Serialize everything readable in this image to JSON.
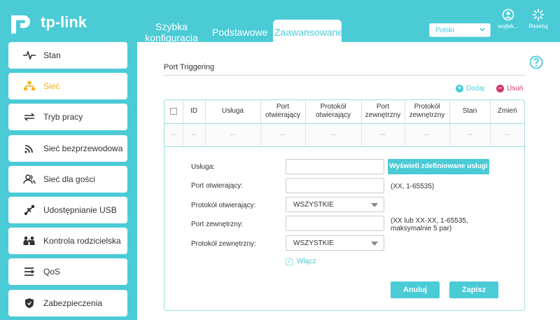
{
  "brand": {
    "logo_text": "tp-link"
  },
  "tabs": {
    "quick": "Szybka konfiguracja",
    "basic": "Podstawowe",
    "advanced": "Zaawansowane"
  },
  "language": {
    "selected": "Polski"
  },
  "header_icons": {
    "user": "wojtek...",
    "reset": "Resetuj"
  },
  "sidebar": {
    "items": [
      {
        "label": "Stan",
        "icon": "pulse-icon"
      },
      {
        "label": "Sieć",
        "icon": "network-icon",
        "active": true
      },
      {
        "label": "Tryb pracy",
        "icon": "mode-arrows-icon"
      },
      {
        "label": "Sieć bezprzewodowa",
        "icon": "wifi-icon"
      },
      {
        "label": "Sieć dla gości",
        "icon": "guests-icon"
      },
      {
        "label": "Udostępnianie USB",
        "icon": "usb-icon"
      },
      {
        "label": "Kontrola rodzicielska",
        "icon": "family-icon"
      },
      {
        "label": "QoS",
        "icon": "qos-icon"
      },
      {
        "label": "Zabezpieczenia",
        "icon": "shield-icon"
      }
    ]
  },
  "section": {
    "title": "Port Triggering"
  },
  "actions": {
    "add": "Dodaj",
    "delete": "Usuń"
  },
  "table": {
    "headers": [
      "ID",
      "Usługa",
      "Port otwierający",
      "Protokół otwierający",
      "Port zewnętrzny",
      "Protokół zewnętrzny",
      "Stan",
      "Zmień"
    ],
    "empty_row": [
      "--",
      "--",
      "--",
      "--",
      "--",
      "--",
      "--",
      "--",
      "--"
    ]
  },
  "form": {
    "service_label": "Usługa:",
    "show_services_button": "Wyświetl zdefiniowane usługi",
    "open_port_label": "Port otwierający:",
    "open_port_hint": "(XX, 1-65535)",
    "open_protocol_label": "Protokół otwierający:",
    "open_protocol_value": "WSZYSTKIE",
    "ext_port_label": "Port zewnętrzny:",
    "ext_port_hint_1": "(XX lub XX-XX, 1-65535,",
    "ext_port_hint_2": "maksymalnie 5 par)",
    "ext_protocol_label": "Protokół zewnętrzny:",
    "ext_protocol_value": "WSZYSTKIE",
    "enable_label": "Włącz",
    "cancel": "Anuluj",
    "save": "Zapisz"
  },
  "colors": {
    "accent": "#4acbd6",
    "active": "#f6b21b",
    "danger": "#d6336c"
  }
}
